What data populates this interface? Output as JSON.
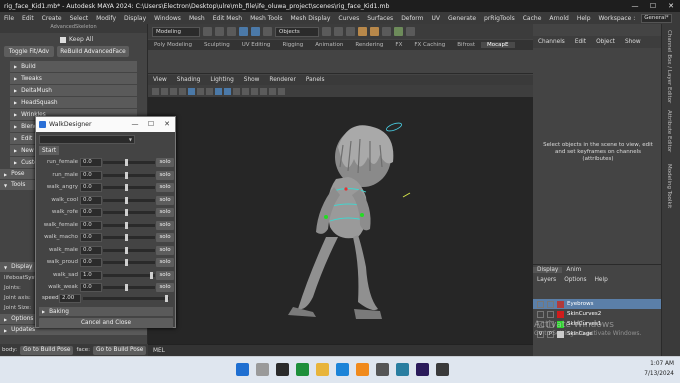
{
  "window": {
    "title": "rig_face_Kid1.mb* - Autodesk MAYA 2024: C:\\Users\\Electron\\Desktop\\ulre\\mb_file\\ife_oluwa_project\\scenes\\rig_face_Kid1.mb",
    "min": "—",
    "max": "☐",
    "close": "✕"
  },
  "menubar": {
    "items": [
      "File",
      "Edit",
      "Create",
      "Select",
      "Modify",
      "Display",
      "Windows",
      "Mesh",
      "Edit Mesh",
      "Mesh Tools",
      "Mesh Display",
      "Curves",
      "Surfaces",
      "Deform",
      "UV",
      "Generate",
      "prRigTools",
      "Cache",
      "Arnold",
      "Help"
    ],
    "workspace_label": "Workspace :",
    "workspace_value": "General*"
  },
  "toolbar": {
    "mode": "Modeling",
    "objects": "Objects"
  },
  "shelf_tabs": [
    "Poly Modeling",
    "Sculpting",
    "UV Editing",
    "Rigging",
    "Animation",
    "Rendering",
    "FX",
    "FX Caching",
    "Bifrost",
    "MocapE"
  ],
  "shelf_active": "MocapE",
  "left_panel": {
    "title": "AdvancedSkeleton",
    "keep_all": "Keep All",
    "toggle_btn": "Toggle Fit/Adv",
    "rebuild_btn": "ReBuild AdvancedFace",
    "frames": [
      "Build",
      "Tweaks",
      "DeltaMush",
      "HeadSquash",
      "Wrinkles",
      "Blend",
      "Edit",
      "New",
      "Custom"
    ],
    "sections": [
      "Pose",
      "Tools",
      "Display",
      "Options",
      "Updates"
    ],
    "labels": [
      "lifeboatSystem",
      "Joints:",
      "Joint axis:",
      "Joint Size:"
    ]
  },
  "status": {
    "body_label": "body:",
    "body_btn": "Go to Build Pose",
    "face_label": "face:",
    "face_btn": "Go to Build Pose"
  },
  "viewport": {
    "menu": [
      "View",
      "Shading",
      "Lighting",
      "Show",
      "Renderer",
      "Panels"
    ]
  },
  "mel": "MEL",
  "right_panel": {
    "menu": [
      "Channels",
      "Edit",
      "Object",
      "Show"
    ],
    "message": "Select objects in the scene to view, edit and set keyframes on channels (attributes)",
    "vtabs": [
      "Channel Box / Layer Editor",
      "Attribute Editor",
      "Modeling Toolkit"
    ]
  },
  "layers": {
    "tabs": [
      "Display",
      "Anim"
    ],
    "menu": [
      "Layers",
      "Options",
      "Help"
    ],
    "rows": [
      {
        "name": "Eyebrows",
        "color": "#b03a3a",
        "v": "",
        "p": ""
      },
      {
        "name": "SkinCurves2",
        "color": "#d01c1c",
        "v": "",
        "p": ""
      },
      {
        "name": "SkinCurves1",
        "color": "#3c4bd6",
        "v": "",
        "p": ""
      },
      {
        "name": "SkinCage",
        "color": "#cccccc",
        "v": "V",
        "p": "P"
      }
    ]
  },
  "dialog": {
    "title": "WalkDesigner",
    "min": "—",
    "max": "☐",
    "close": "✕",
    "start": "Start",
    "rows": [
      {
        "name": "run_female",
        "value": "0.0",
        "level": 0.43
      },
      {
        "name": "run_male",
        "value": "0.0",
        "level": 0.43
      },
      {
        "name": "walk_angry",
        "value": "0.0",
        "level": 0.43
      },
      {
        "name": "walk_cool",
        "value": "0.0",
        "level": 0.43
      },
      {
        "name": "walk_rofe",
        "value": "0.0",
        "level": 0.43
      },
      {
        "name": "walk_female",
        "value": "0.0",
        "level": 0.43
      },
      {
        "name": "walk_macho",
        "value": "0.0",
        "level": 0.43
      },
      {
        "name": "walk_male",
        "value": "0.0",
        "level": 0.43
      },
      {
        "name": "walk_proud",
        "value": "0.0",
        "level": 0.43
      },
      {
        "name": "walk_sad",
        "value": "1.0",
        "level": 0.94
      },
      {
        "name": "walk_weak",
        "value": "0.0",
        "level": 0.43
      }
    ],
    "solo": "solo",
    "speed_label": "speed",
    "speed_value": "2.00",
    "baking": "Baking",
    "cancel": "Cancel and Close"
  },
  "activate": {
    "line1": "Activate Windows",
    "line2": "Go to Settings to activate Windows."
  },
  "tray": {
    "time": "1:07 AM",
    "date": "7/13/2024"
  }
}
